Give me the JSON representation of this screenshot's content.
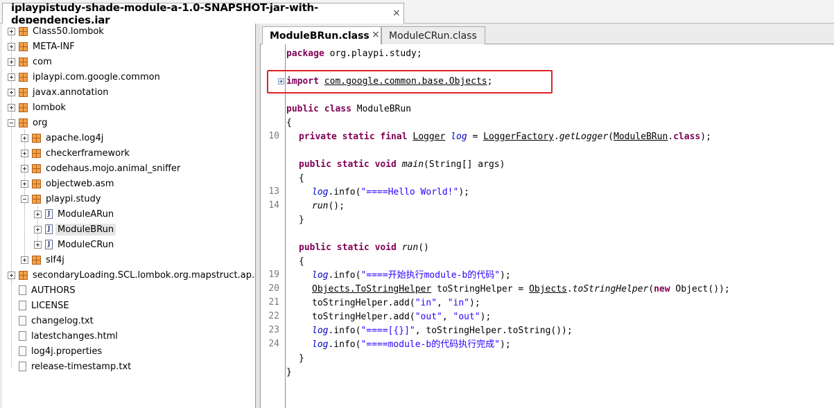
{
  "window": {
    "tab_title": "iplaypistudy-shade-module-a-1.0-SNAPSHOT-jar-with-dependencies.jar",
    "tab_close": "×"
  },
  "tree": {
    "nodes": [
      {
        "label": "Class50.lombok"
      },
      {
        "label": "META-INF"
      },
      {
        "label": "com"
      },
      {
        "label": "iplaypi.com.google.common"
      },
      {
        "label": "javax.annotation"
      },
      {
        "label": "lombok"
      },
      {
        "label": "org"
      },
      {
        "label": "apache.log4j"
      },
      {
        "label": "checkerframework"
      },
      {
        "label": "codehaus.mojo.animal_sniffer"
      },
      {
        "label": "objectweb.asm"
      },
      {
        "label": "playpi.study"
      },
      {
        "label": "ModuleARun"
      },
      {
        "label": "ModuleBRun"
      },
      {
        "label": "ModuleCRun"
      },
      {
        "label": "slf4j"
      },
      {
        "label": "secondaryLoading.SCL.lombok.org.mapstruct.ap.spi"
      },
      {
        "label": "AUTHORS"
      },
      {
        "label": "LICENSE"
      },
      {
        "label": "changelog.txt"
      },
      {
        "label": "latestchanges.html"
      },
      {
        "label": "log4j.properties"
      },
      {
        "label": "release-timestamp.txt"
      }
    ],
    "jfile_glyph": "J"
  },
  "editor": {
    "tabs": [
      {
        "label": "ModuleBRun.class",
        "close": "×"
      },
      {
        "label": "ModuleCRun.class"
      }
    ],
    "line_numbers": [
      "10",
      "13",
      "14",
      "19",
      "20",
      "21",
      "22",
      "23",
      "24"
    ],
    "code": {
      "l1_kw": "package",
      "l1_rest": " org.playpi.study;",
      "l2_kw": "import",
      "l2_pkg": "com.google.common.base.Objects",
      "l2_semi": ";",
      "l3_kw": "public class",
      "l3_rest": " ModuleBRun",
      "l4": "{",
      "l5_kw": "private static final",
      "l5_type": "Logger",
      "l5_var": "log",
      "l5_eq": " = ",
      "l5_factory": "LoggerFactory",
      "l5_dot": ".",
      "l5_method": "getLogger",
      "l5_paren": "(",
      "l5_cls": "ModuleBRun",
      "l5_dotclass": ".",
      "l5_classkw": "class",
      "l5_end": ");",
      "l6_kw": "public static void",
      "l6_method": "main",
      "l6_rest": "(String[] args)",
      "l7": "{",
      "l8_var": "log",
      "l8_mid": ".info(",
      "l8_str": "\"====Hello World!\"",
      "l8_end": ");",
      "l9_method": "run",
      "l9_end": "();",
      "l10": "}",
      "l11_kw": "public static void",
      "l11_method": "run",
      "l11_rest": "()",
      "l12": "{",
      "l13_var": "log",
      "l13_mid": ".info(",
      "l13_str": "\"====开始执行module-b的代码\"",
      "l13_end": ");",
      "l14_type": "Objects.ToStringHelper",
      "l14_mid": " toStringHelper = ",
      "l14_cls": "Objects",
      "l14_dot": ".",
      "l14_method": "toStringHelper",
      "l14_paren": "(",
      "l14_kw": "new",
      "l14_end": " Object());",
      "l15_pre": "toStringHelper.add(",
      "l15_s1": "\"in\"",
      "l15_comma": ", ",
      "l15_s2": "\"in\"",
      "l15_end": ");",
      "l16_pre": "toStringHelper.add(",
      "l16_s1": "\"out\"",
      "l16_comma": ", ",
      "l16_s2": "\"out\"",
      "l16_end": ");",
      "l17_var": "log",
      "l17_mid": ".info(",
      "l17_str": "\"====[{}]\"",
      "l17_end": ", toStringHelper.toString());",
      "l18_var": "log",
      "l18_mid": ".info(",
      "l18_str": "\"====module-b的代码执行完成\"",
      "l18_end": ");",
      "l19": "}",
      "l20": "}"
    }
  },
  "colors": {
    "keyword": "#7f0055",
    "string": "#2a00ff",
    "annotation_box": "#e02020",
    "package_icon": "#c86a14"
  },
  "icons": {
    "package": "package-icon",
    "expand": "expand-icon",
    "file": "file-icon",
    "class": "java-class-icon",
    "fold": "fold-expand-icon"
  }
}
